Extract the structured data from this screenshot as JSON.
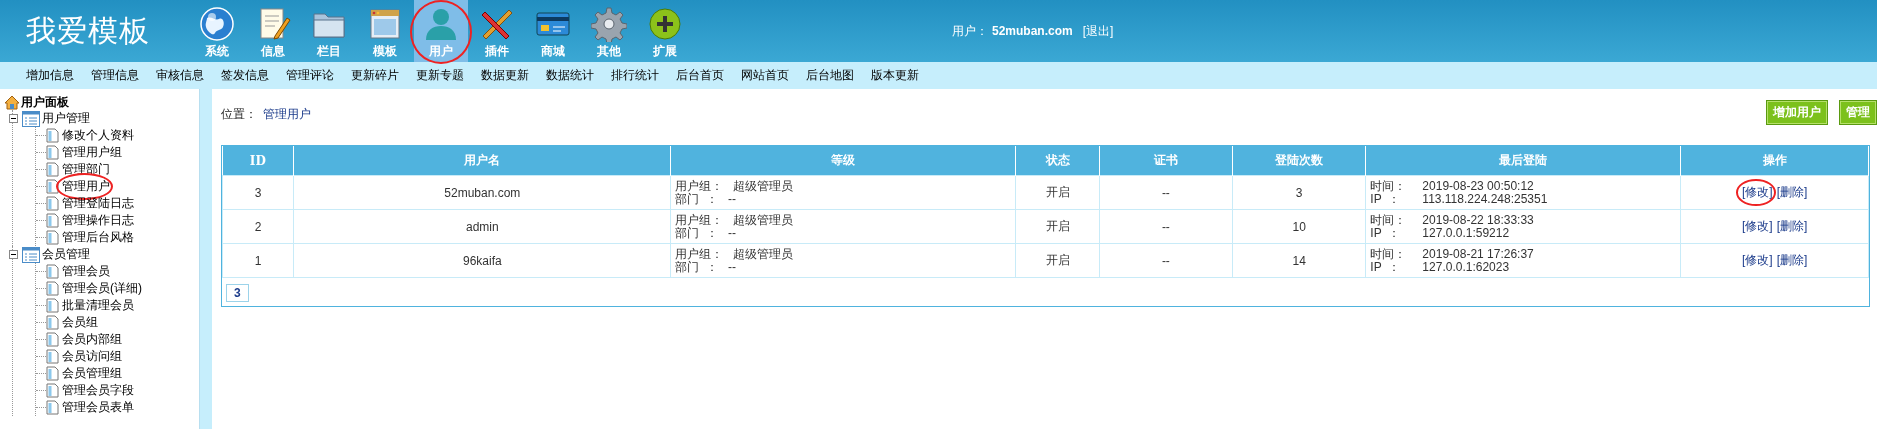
{
  "logo": "我爱模板",
  "nav": [
    {
      "label": "系统",
      "kind": "globe",
      "selected": false,
      "circled": false
    },
    {
      "label": "信息",
      "kind": "notepad",
      "selected": false,
      "circled": false
    },
    {
      "label": "栏目",
      "kind": "folder",
      "selected": false,
      "circled": false
    },
    {
      "label": "模板",
      "kind": "window",
      "selected": false,
      "circled": false
    },
    {
      "label": "用户",
      "kind": "person",
      "selected": true,
      "circled": true
    },
    {
      "label": "插件",
      "kind": "tools",
      "selected": false,
      "circled": false
    },
    {
      "label": "商城",
      "kind": "card",
      "selected": false,
      "circled": false
    },
    {
      "label": "其他",
      "kind": "gear",
      "selected": false,
      "circled": false
    },
    {
      "label": "扩展",
      "kind": "plus",
      "selected": false,
      "circled": false
    }
  ],
  "user_info": {
    "label": "用户：",
    "username": "52muban.com",
    "logout": "[退出]"
  },
  "menu": [
    "增加信息",
    "管理信息",
    "审核信息",
    "签发信息",
    "管理评论",
    "更新碎片",
    "更新专题",
    "数据更新",
    "数据统计",
    "排行统计",
    "后台首页",
    "网站首页",
    "后台地图",
    "版本更新"
  ],
  "sidebar": {
    "title": "用户面板",
    "groups": [
      {
        "label": "用户管理",
        "expanded": true,
        "children": [
          {
            "label": "修改个人资料",
            "circled": false
          },
          {
            "label": "管理用户组",
            "circled": false
          },
          {
            "label": "管理部门",
            "circled": false
          },
          {
            "label": "管理用户",
            "circled": true
          },
          {
            "label": "管理登陆日志",
            "circled": false
          },
          {
            "label": "管理操作日志",
            "circled": false
          },
          {
            "label": "管理后台风格",
            "circled": false
          }
        ]
      },
      {
        "label": "会员管理",
        "expanded": true,
        "children": [
          {
            "label": "管理会员",
            "circled": false
          },
          {
            "label": "管理会员(详细)",
            "circled": false
          },
          {
            "label": "批量清理会员",
            "circled": false
          },
          {
            "label": "会员组",
            "circled": false
          },
          {
            "label": "会员内部组",
            "circled": false
          },
          {
            "label": "会员访问组",
            "circled": false
          },
          {
            "label": "会员管理组",
            "circled": false
          },
          {
            "label": "管理会员字段",
            "circled": false
          },
          {
            "label": "管理会员表单",
            "circled": false
          }
        ]
      }
    ]
  },
  "breadcrumb": {
    "label": "位置：",
    "link": "管理用户"
  },
  "buttons": [
    "增加用户",
    "管理"
  ],
  "table": {
    "columns": [
      "ID",
      "用户名",
      "等级",
      "状态",
      "证书",
      "登陆次数",
      "最后登陆",
      "操作"
    ],
    "rows": [
      {
        "id": "3",
        "username": "52muban.com",
        "group_label": "用户组：",
        "group": "超级管理员",
        "dept_label": "部门  ：",
        "dept": "--",
        "status": "开启",
        "cert": "--",
        "logins": "3",
        "time_label": "时间：",
        "time": "2019-08-23 00:50:12",
        "ip_label": "IP  ：",
        "ip": "113.118.224.248:25351",
        "actions": [
          {
            "label": "[修改]",
            "circled": true
          },
          {
            "label": "[删除]",
            "circled": false
          }
        ]
      },
      {
        "id": "2",
        "username": "admin",
        "group_label": "用户组：",
        "group": "超级管理员",
        "dept_label": "部门  ：",
        "dept": "--",
        "status": "开启",
        "cert": "--",
        "logins": "10",
        "time_label": "时间：",
        "time": "2019-08-22 18:33:33",
        "ip_label": "IP  ：",
        "ip": "127.0.0.1:59212",
        "actions": [
          {
            "label": "[修改]",
            "circled": false
          },
          {
            "label": "[删除]",
            "circled": false
          }
        ]
      },
      {
        "id": "1",
        "username": "96kaifa",
        "group_label": "用户组：",
        "group": "超级管理员",
        "dept_label": "部门  ：",
        "dept": "--",
        "status": "开启",
        "cert": "--",
        "logins": "14",
        "time_label": "时间：",
        "time": "2019-08-21 17:26:37",
        "ip_label": "IP  ：",
        "ip": "127.0.0.1:62023",
        "actions": [
          {
            "label": "[修改]",
            "circled": false
          },
          {
            "label": "[删除]",
            "circled": false
          }
        ]
      }
    ]
  },
  "pagination": [
    {
      "label": "3",
      "selected": true
    }
  ]
}
